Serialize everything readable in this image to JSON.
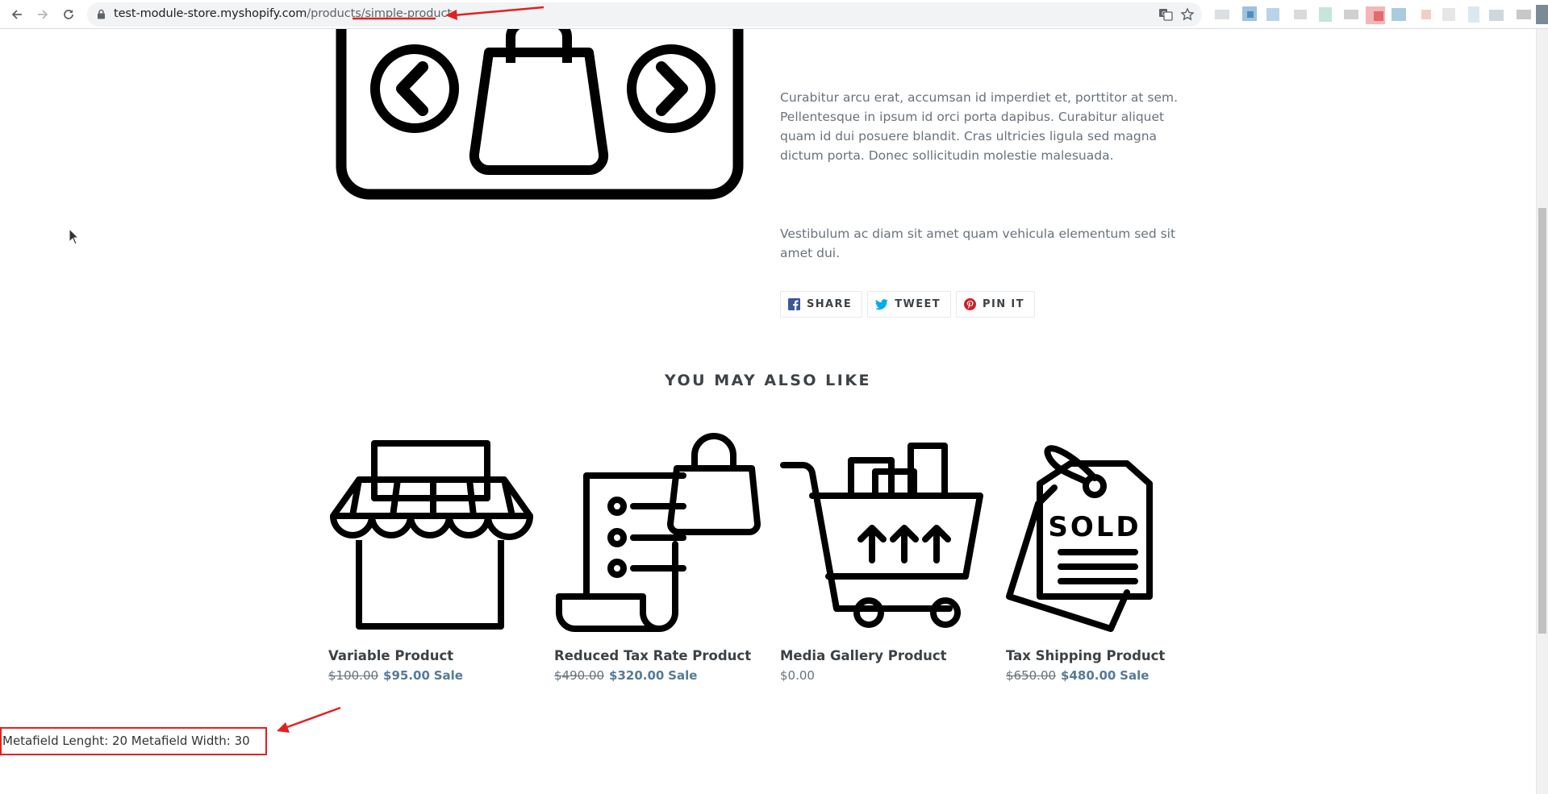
{
  "browser": {
    "url_host": "test-module-store.myshopify.com",
    "url_path": "/products/simple-product"
  },
  "product": {
    "description_1": "Curabitur arcu erat, accumsan id imperdiet et, porttitor at sem. Pellentesque in ipsum id orci porta dapibus. Curabitur aliquet quam id dui posuere blandit. Cras ultricies ligula sed magna dictum porta. Donec sollicitudin molestie malesuada.",
    "description_2": "Vestibulum ac diam sit amet quam vehicula elementum sed sit amet dui.",
    "share": {
      "share_label": "SHARE",
      "tweet_label": "TWEET",
      "pin_label": "PIN IT"
    }
  },
  "recommendations": {
    "title": "YOU MAY ALSO LIKE",
    "items": [
      {
        "title": "Variable Product",
        "old_price": "$100.00",
        "price": "$95.00",
        "sale_label": "Sale",
        "icon": "storefront-icon"
      },
      {
        "title": "Reduced Tax Rate Product",
        "old_price": "$490.00",
        "price": "$320.00",
        "sale_label": "Sale",
        "icon": "receipt-bag-icon"
      },
      {
        "title": "Media Gallery Product",
        "price": "$0.00",
        "icon": "shopping-cart-icon"
      },
      {
        "title": "Tax Shipping Product",
        "old_price": "$650.00",
        "price": "$480.00",
        "sale_label": "Sale",
        "icon": "sold-tag-icon",
        "tag_text": "SOLD"
      }
    ]
  },
  "metafield": {
    "text": "Metafield Lenght: 20 Metafield Width: 30"
  },
  "colors": {
    "annotation": "#e32020",
    "sale": "#557b97",
    "text": "#3d4246",
    "muted": "#69727b"
  }
}
